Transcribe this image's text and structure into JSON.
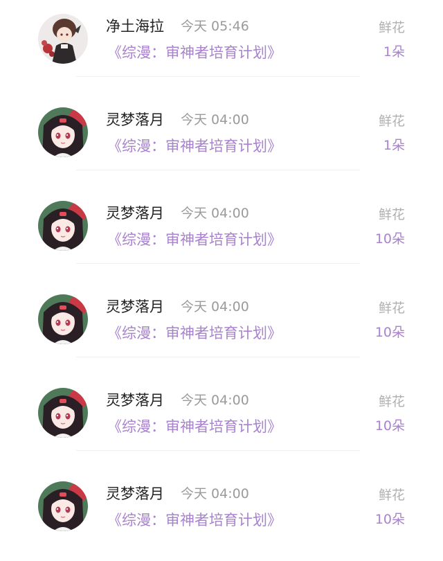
{
  "colors": {
    "accent": "#a882cf",
    "name_text": "#222222",
    "muted_text": "#9a9a9a"
  },
  "records": [
    {
      "username": "净土海拉",
      "time": "今天 05:46",
      "book": "《综漫：审神者培育计划》",
      "gift_label": "鲜花",
      "amount": "1朵",
      "avatar": "gothic-girl-avatar"
    },
    {
      "username": "灵梦落月",
      "time": "今天 04:00",
      "book": "《综漫：审神者培育计划》",
      "gift_label": "鲜花",
      "amount": "1朵",
      "avatar": "anime-girl-avatar"
    },
    {
      "username": "灵梦落月",
      "time": "今天 04:00",
      "book": "《综漫：审神者培育计划》",
      "gift_label": "鲜花",
      "amount": "10朵",
      "avatar": "anime-girl-avatar"
    },
    {
      "username": "灵梦落月",
      "time": "今天 04:00",
      "book": "《综漫：审神者培育计划》",
      "gift_label": "鲜花",
      "amount": "10朵",
      "avatar": "anime-girl-avatar"
    },
    {
      "username": "灵梦落月",
      "time": "今天 04:00",
      "book": "《综漫：审神者培育计划》",
      "gift_label": "鲜花",
      "amount": "10朵",
      "avatar": "anime-girl-avatar"
    },
    {
      "username": "灵梦落月",
      "time": "今天 04:00",
      "book": "《综漫：审神者培育计划》",
      "gift_label": "鲜花",
      "amount": "10朵",
      "avatar": "anime-girl-avatar"
    }
  ]
}
